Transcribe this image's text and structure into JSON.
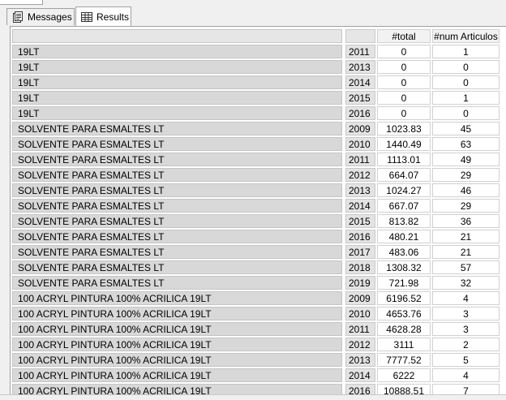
{
  "tabs": [
    {
      "label": "Messages",
      "icon": "messages-icon"
    },
    {
      "label": "Results",
      "icon": "grid-icon"
    }
  ],
  "columns": {
    "name": "",
    "year": "",
    "total": "#total",
    "num": "#num Articulos"
  },
  "rows": [
    {
      "name": "19LT",
      "year": "2011",
      "total": "0",
      "num": "1"
    },
    {
      "name": "19LT",
      "year": "2013",
      "total": "0",
      "num": "0"
    },
    {
      "name": "19LT",
      "year": "2014",
      "total": "0",
      "num": "0"
    },
    {
      "name": "19LT",
      "year": "2015",
      "total": "0",
      "num": "1"
    },
    {
      "name": "19LT",
      "year": "2016",
      "total": "0",
      "num": "0"
    },
    {
      "name": "SOLVENTE PARA ESMALTES LT",
      "year": "2009",
      "total": "1023.83",
      "num": "45"
    },
    {
      "name": "SOLVENTE PARA ESMALTES LT",
      "year": "2010",
      "total": "1440.49",
      "num": "63"
    },
    {
      "name": "SOLVENTE PARA ESMALTES LT",
      "year": "2011",
      "total": "1113.01",
      "num": "49"
    },
    {
      "name": "SOLVENTE PARA ESMALTES LT",
      "year": "2012",
      "total": "664.07",
      "num": "29"
    },
    {
      "name": "SOLVENTE PARA ESMALTES LT",
      "year": "2013",
      "total": "1024.27",
      "num": "46"
    },
    {
      "name": "SOLVENTE PARA ESMALTES LT",
      "year": "2014",
      "total": "667.07",
      "num": "29"
    },
    {
      "name": "SOLVENTE PARA ESMALTES LT",
      "year": "2015",
      "total": "813.82",
      "num": "36"
    },
    {
      "name": "SOLVENTE PARA ESMALTES LT",
      "year": "2016",
      "total": "480.21",
      "num": "21"
    },
    {
      "name": "SOLVENTE PARA ESMALTES LT",
      "year": "2017",
      "total": "483.06",
      "num": "21"
    },
    {
      "name": "SOLVENTE PARA ESMALTES LT",
      "year": "2018",
      "total": "1308.32",
      "num": "57"
    },
    {
      "name": "SOLVENTE PARA ESMALTES LT",
      "year": "2019",
      "total": "721.98",
      "num": "32"
    },
    {
      "name": "100 ACRYL PINTURA 100% ACRILICA 19LT",
      "year": "2009",
      "total": "6196.52",
      "num": "4"
    },
    {
      "name": "100 ACRYL PINTURA 100% ACRILICA 19LT",
      "year": "2010",
      "total": "4653.76",
      "num": "3"
    },
    {
      "name": "100 ACRYL PINTURA 100% ACRILICA 19LT",
      "year": "2011",
      "total": "4628.28",
      "num": "3"
    },
    {
      "name": "100 ACRYL PINTURA 100% ACRILICA 19LT",
      "year": "2012",
      "total": "3111",
      "num": "2"
    },
    {
      "name": "100 ACRYL PINTURA 100% ACRILICA 19LT",
      "year": "2013",
      "total": "7777.52",
      "num": "5"
    },
    {
      "name": "100 ACRYL PINTURA 100% ACRILICA 19LT",
      "year": "2014",
      "total": "6222",
      "num": "4"
    },
    {
      "name": "100 ACRYL PINTURA 100% ACRILICA 19LT",
      "year": "2016",
      "total": "10888.51",
      "num": "7"
    }
  ]
}
